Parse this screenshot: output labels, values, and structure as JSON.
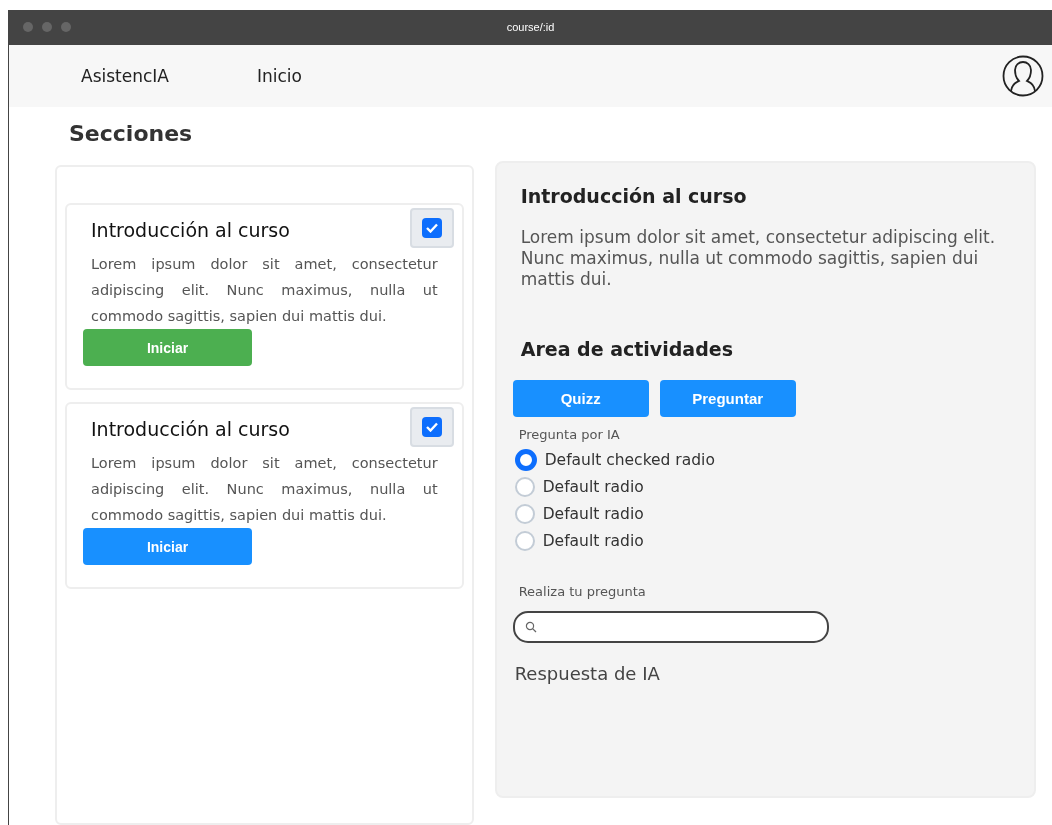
{
  "window": {
    "title": "course/:id"
  },
  "nav": {
    "brand": "AsistencIA",
    "links": [
      "Inicio"
    ]
  },
  "sections": {
    "title": "Secciones",
    "cards": [
      {
        "title": "Introducción al curso",
        "checked": true,
        "text": "Lorem ipsum dolor sit amet, consectetur adipiscing elit. Nunc maximus, nulla ut commodo sagittis, sapien dui mattis dui.",
        "button": {
          "label": "Iniciar",
          "color": "#4caf50"
        }
      },
      {
        "title": "Introducción al curso",
        "checked": true,
        "text": "Lorem ipsum dolor sit amet, consectetur adipiscing elit. Nunc maximus, nulla ut commodo sagittis, sapien dui mattis dui.",
        "button": {
          "label": "Iniciar",
          "color": "#1890ff"
        }
      }
    ]
  },
  "detail": {
    "title": "Introducción al curso",
    "text": "Lorem ipsum dolor sit amet, consectetur adipiscing elit. Nunc maximus, nulla ut commodo sagittis, sapien dui mattis dui.",
    "activities_title": "Area de actividades",
    "buttons": [
      "Quizz",
      "Preguntar"
    ],
    "radio_label": "Pregunta por IA",
    "radios": [
      {
        "label": "Default checked radio",
        "selected": true
      },
      {
        "label": "Default radio",
        "selected": false
      },
      {
        "label": "Default radio",
        "selected": false
      },
      {
        "label": "Default radio",
        "selected": false
      }
    ],
    "question_label": "Realiza tu pregunta",
    "answer_title": "Respuesta de IA"
  }
}
